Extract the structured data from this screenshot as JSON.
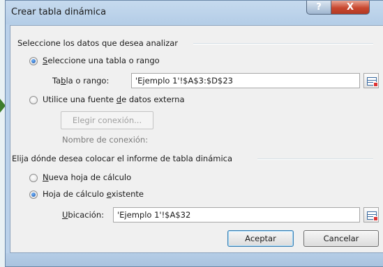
{
  "window": {
    "title": "Crear tabla dinámica",
    "help_label": "?",
    "close_label": "X"
  },
  "section_data": {
    "title": "Seleccione los datos que desea analizar",
    "option_table": {
      "label_key": "S",
      "label_rest": "eleccione una tabla o rango",
      "selected": true
    },
    "range": {
      "label_pre": "Ta",
      "label_key": "b",
      "label_post": "la o rango:",
      "value": "'Ejemplo 1'!$A$3:$D$23"
    },
    "option_external": {
      "label_pre": "Utilice una fuente ",
      "label_key": "d",
      "label_post": "e datos externa",
      "selected": false
    },
    "choose_connection_label": "Elegir conexión...",
    "connection_name_label": "Nombre de conexión:"
  },
  "section_location": {
    "title": "Elija dónde desea colocar el informe de tabla dinámica",
    "option_new": {
      "label_key": "N",
      "label_rest": "ueva hoja de cálculo",
      "selected": false
    },
    "option_existing": {
      "label_pre": "Hoja de cálculo ",
      "label_key": "e",
      "label_post": "xistente",
      "selected": true
    },
    "location": {
      "label_key": "U",
      "label_rest": "bicación:",
      "value": "'Ejemplo 1'!$A$32"
    }
  },
  "buttons": {
    "accept": "Aceptar",
    "cancel": "Cancelar"
  }
}
